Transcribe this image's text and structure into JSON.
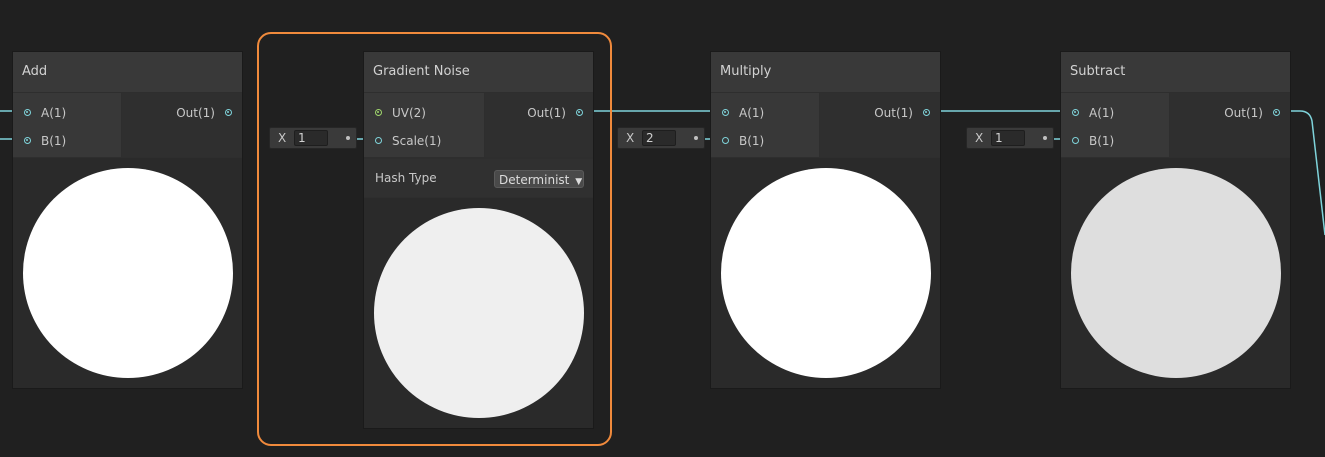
{
  "colors": {
    "background": "#202020",
    "wire": "#7fd3da",
    "uv_wire": "#9fd56c",
    "group_border": "#f08a3c"
  },
  "nodes": {
    "add": {
      "title": "Add",
      "inputs": [
        "A(1)",
        "B(1)"
      ],
      "output": "Out(1)"
    },
    "gradient_noise": {
      "title": "Gradient Noise",
      "inputs": [
        "UV(2)",
        "Scale(1)"
      ],
      "output": "Out(1)",
      "setting_label": "Hash Type",
      "setting_value": "Determinist",
      "scale_field": {
        "axis": "X",
        "value": "1"
      }
    },
    "multiply": {
      "title": "Multiply",
      "inputs": [
        "A(1)",
        "B(1)"
      ],
      "output": "Out(1)",
      "b_field": {
        "axis": "X",
        "value": "2"
      }
    },
    "subtract": {
      "title": "Subtract",
      "inputs": [
        "A(1)",
        "B(1)"
      ],
      "output": "Out(1)",
      "b_field": {
        "axis": "X",
        "value": "1"
      }
    }
  },
  "icons": {
    "dropdown": "caret-down-icon"
  }
}
